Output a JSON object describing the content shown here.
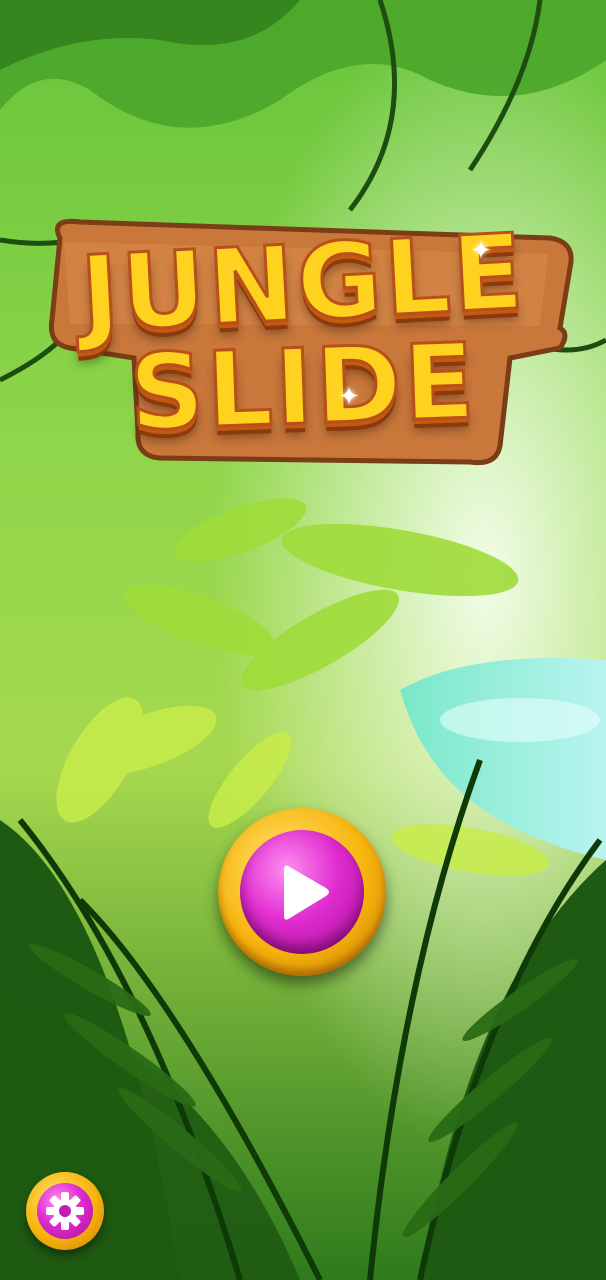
{
  "game": {
    "title_line1": "JUNGLE",
    "title_line2": "SLIDE"
  },
  "controls": {
    "play": {
      "icon": "play-triangle-icon",
      "color": "#e02ccf",
      "ring_color": "#f7b30c"
    },
    "settings": {
      "icon": "gear-icon",
      "color": "#e02ccf",
      "ring_color": "#f7b30c"
    }
  },
  "colors": {
    "title_fill": "#ffd21f",
    "title_outline": "#b8501a",
    "plank": "#c9773a",
    "foliage_dark": "#1f5a12",
    "water": "#6fe3d6"
  }
}
